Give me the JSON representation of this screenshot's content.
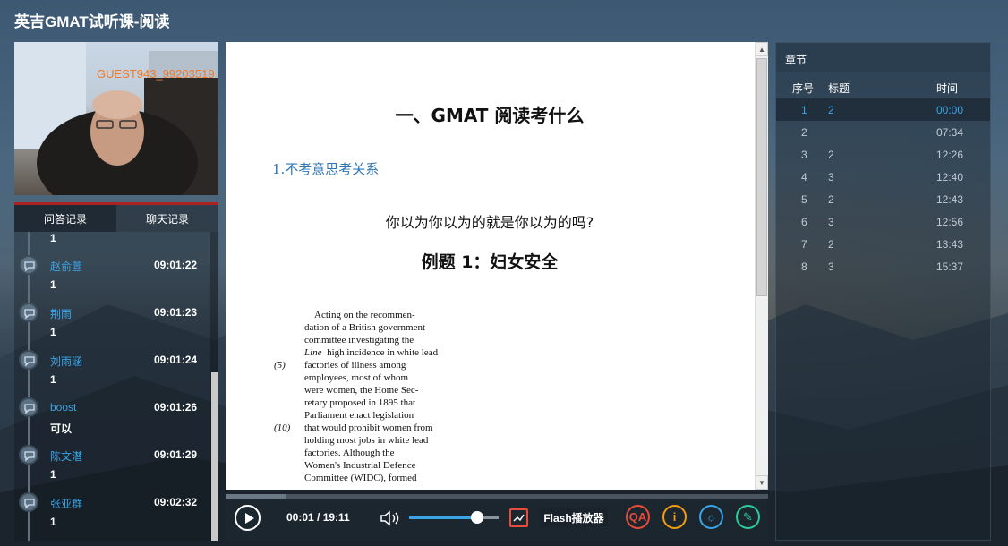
{
  "app": {
    "title": "英吉GMAT试听课-阅读"
  },
  "video": {
    "username": "GUEST943_99203519"
  },
  "left_tabs": [
    {
      "label": "问答记录",
      "active": true
    },
    {
      "label": "聊天记录",
      "active": false
    }
  ],
  "qa": {
    "first_msg": "1",
    "items": [
      {
        "name": "赵俞萱",
        "time": "09:01:22",
        "msg": "1"
      },
      {
        "name": "荆雨",
        "time": "09:01:23",
        "msg": "1"
      },
      {
        "name": "刘雨涵",
        "time": "09:01:24",
        "msg": "1"
      },
      {
        "name": "boost",
        "time": "09:01:26",
        "msg": "可以"
      },
      {
        "name": "陈文潜",
        "time": "09:01:29",
        "msg": "1"
      },
      {
        "name": "张亚群",
        "time": "09:02:32",
        "msg": "1"
      }
    ]
  },
  "doc": {
    "heading": "一、GMAT 阅读考什么",
    "subheading": "1.不考意思考关系",
    "question": "你以为你以为的就是你以为的吗?",
    "example": "例题 1：妇女安全",
    "passage": [
      {
        "num": "",
        "text": "    Acting on the recommen-"
      },
      {
        "num": "",
        "text": "dation of a British government"
      },
      {
        "num": "",
        "text": "committee investigating the"
      },
      {
        "num": "",
        "text": "high incidence in white lead",
        "prefix": "Line"
      },
      {
        "num": "(5)",
        "text": "factories of illness among"
      },
      {
        "num": "",
        "text": "employees, most of whom"
      },
      {
        "num": "",
        "text": "were women, the Home Sec-"
      },
      {
        "num": "",
        "text": "retary proposed in 1895 that"
      },
      {
        "num": "",
        "text": "Parliament enact legislation"
      },
      {
        "num": "(10)",
        "text": "that would prohibit women from"
      },
      {
        "num": "",
        "text": "holding most jobs in white lead"
      },
      {
        "num": "",
        "text": "factories.  Although the"
      },
      {
        "num": "",
        "text": "Women's Industrial Defence"
      },
      {
        "num": "",
        "text": "Committee (WIDC), formed"
      }
    ]
  },
  "player": {
    "time": "00:01 / 19:11",
    "progress": 0.11,
    "volume": 0.76,
    "flash_label": "Flash播放器",
    "tools": [
      {
        "label": "QA",
        "color": "#e74c3c"
      },
      {
        "label": "i",
        "color": "#f39c12"
      },
      {
        "label": "☼",
        "color": "#3ba5e6"
      },
      {
        "label": "✎",
        "color": "#2ecc9a"
      }
    ]
  },
  "chapters": {
    "header": "章节",
    "columns": [
      "序号",
      "标题",
      "时间"
    ],
    "rows": [
      {
        "num": "1",
        "title": "2",
        "time": "00:00",
        "active": true
      },
      {
        "num": "2",
        "title": "",
        "time": "07:34"
      },
      {
        "num": "3",
        "title": "2",
        "time": "12:26"
      },
      {
        "num": "4",
        "title": "3",
        "time": "12:40"
      },
      {
        "num": "5",
        "title": "2",
        "time": "12:43"
      },
      {
        "num": "6",
        "title": "3",
        "time": "12:56"
      },
      {
        "num": "7",
        "title": "2",
        "time": "13:43"
      },
      {
        "num": "8",
        "title": "3",
        "time": "15:37"
      }
    ]
  }
}
